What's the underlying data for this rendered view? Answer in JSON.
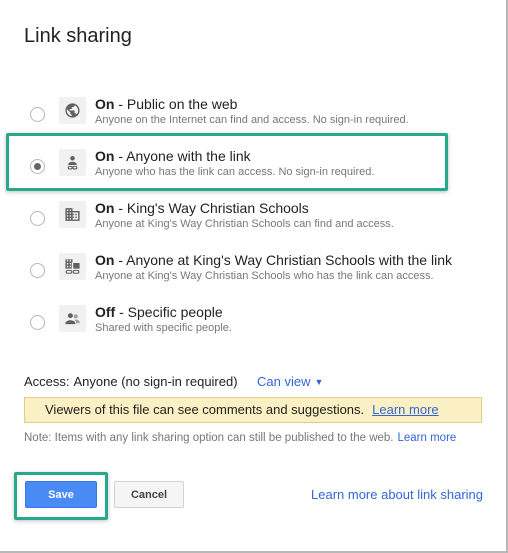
{
  "dialog": {
    "title": "Link sharing"
  },
  "options": [
    {
      "state": "On",
      "sep": " - ",
      "label": "Public on the web",
      "desc": "Anyone on the Internet can find and access. No sign-in required.",
      "icon": "globe-icon",
      "checked": false
    },
    {
      "state": "On",
      "sep": " - ",
      "label": "Anyone with the link",
      "desc": "Anyone who has the link can access. No sign-in required.",
      "icon": "person-link-icon",
      "checked": true
    },
    {
      "state": "On",
      "sep": " - ",
      "label": "King's Way Christian Schools",
      "desc": "Anyone at King's Way Christian Schools can find and access.",
      "icon": "building-icon",
      "checked": false
    },
    {
      "state": "On",
      "sep": " - ",
      "label": "Anyone at King's Way Christian Schools with the link",
      "desc": "Anyone at King's Way Christian Schools who has the link can access.",
      "icon": "building-link-icon",
      "checked": false
    },
    {
      "state": "Off",
      "sep": " - ",
      "label": "Specific people",
      "desc": "Shared with specific people.",
      "icon": "people-icon",
      "checked": false
    }
  ],
  "access": {
    "label": "Access:",
    "value": "Anyone (no sign-in required)",
    "dropdown": "Can view"
  },
  "warning": {
    "text": "Viewers of this file can see comments and suggestions.",
    "link": "Learn more"
  },
  "note": {
    "text": "Note: Items with any link sharing option can still be published to the web.",
    "link": "Learn more"
  },
  "buttons": {
    "save": "Save",
    "cancel": "Cancel"
  },
  "footer_link": "Learn more about link sharing",
  "colors": {
    "accent": "#4a8af4",
    "link": "#3367d6",
    "highlight": "#26a98b",
    "warning_bg": "#fbf0c3"
  }
}
